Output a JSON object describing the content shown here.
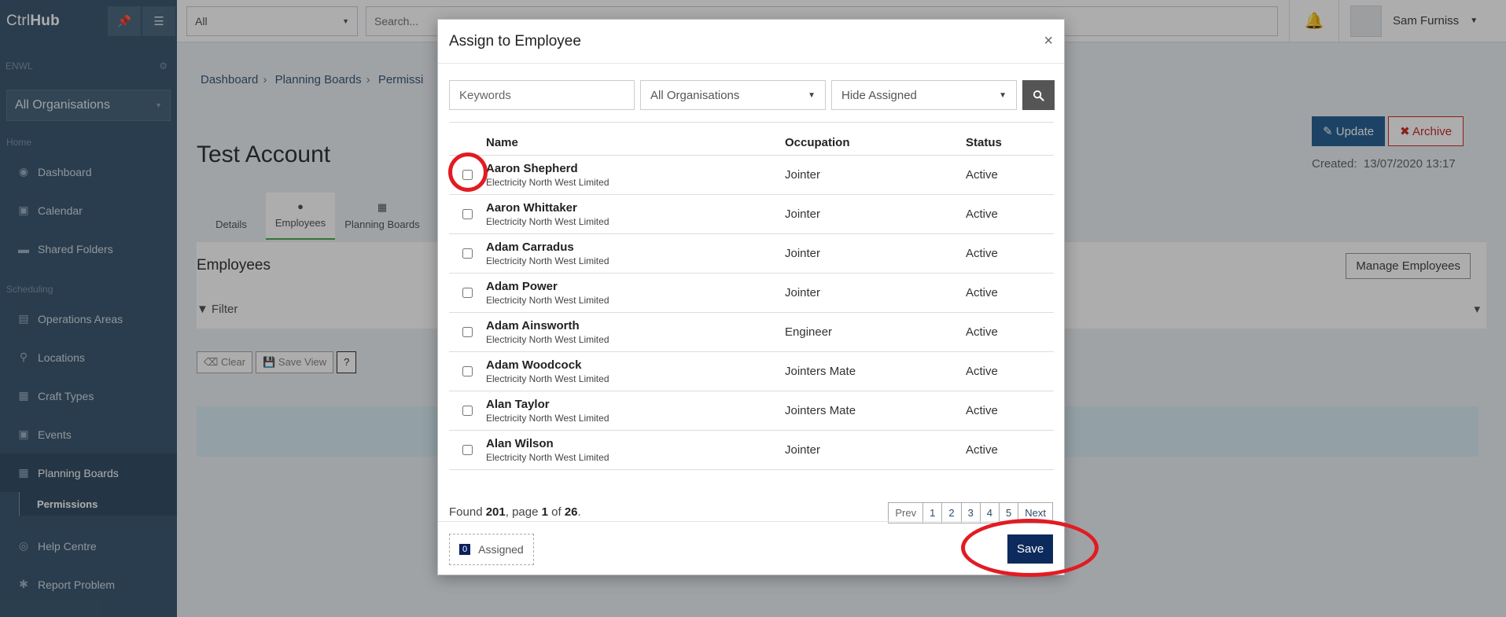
{
  "app": {
    "brand_plain": "Ctrl",
    "brand_bold": "Hub",
    "tenant": "ENWL",
    "org_select": "All Organisations"
  },
  "sidebar": {
    "section_home": "Home",
    "section_scheduling": "Scheduling",
    "items": [
      {
        "label": "Dashboard",
        "icon": "dashboard-icon"
      },
      {
        "label": "Calendar",
        "icon": "calendar-icon"
      },
      {
        "label": "Shared Folders",
        "icon": "folder-icon"
      },
      {
        "label": "Operations Areas",
        "icon": "map-icon"
      },
      {
        "label": "Locations",
        "icon": "pin-icon"
      },
      {
        "label": "Craft Types",
        "icon": "table-icon"
      },
      {
        "label": "Events",
        "icon": "calendar-icon"
      },
      {
        "label": "Planning Boards",
        "icon": "grid-icon"
      }
    ],
    "sub_item": "Permissions",
    "help": "Help Centre",
    "report": "Report Problem"
  },
  "topbar": {
    "select_value": "All",
    "search_placeholder": "Search...",
    "user_name": "Sam Furniss"
  },
  "page": {
    "breadcrumb": [
      "Dashboard",
      "Planning Boards",
      "Permissi"
    ],
    "title": "Test Account",
    "tabs": [
      "Details",
      "Employees",
      "Planning Boards"
    ],
    "update_label": "Update",
    "archive_label": "Archive",
    "created_label": "Created:",
    "created_value": "13/07/2020 13:17",
    "panel_title": "Employees",
    "manage_label": "Manage Employees",
    "filter_label": "Filter",
    "clear_label": "Clear",
    "save_view_label": "Save View",
    "help_glyph": "?"
  },
  "modal": {
    "title": "Assign to Employee",
    "keywords_placeholder": "Keywords",
    "org_filter": "All Organisations",
    "assigned_filter": "Hide Assigned",
    "columns": {
      "name": "Name",
      "occupation": "Occupation",
      "status": "Status"
    },
    "rows": [
      {
        "name": "Aaron Shepherd",
        "org": "Electricity North West Limited",
        "occupation": "Jointer",
        "status": "Active"
      },
      {
        "name": "Aaron Whittaker",
        "org": "Electricity North West Limited",
        "occupation": "Jointer",
        "status": "Active"
      },
      {
        "name": "Adam Carradus",
        "org": "Electricity North West Limited",
        "occupation": "Jointer",
        "status": "Active"
      },
      {
        "name": "Adam Power",
        "org": "Electricity North West Limited",
        "occupation": "Jointer",
        "status": "Active"
      },
      {
        "name": "Adam Ainsworth",
        "org": "Electricity North West Limited",
        "occupation": "Engineer",
        "status": "Active"
      },
      {
        "name": "Adam Woodcock",
        "org": "Electricity North West Limited",
        "occupation": "Jointers Mate",
        "status": "Active"
      },
      {
        "name": "Alan Taylor",
        "org": "Electricity North West Limited",
        "occupation": "Jointers Mate",
        "status": "Active"
      },
      {
        "name": "Alan Wilson",
        "org": "Electricity North West Limited",
        "occupation": "Jointer",
        "status": "Active"
      }
    ],
    "found": {
      "prefix": "Found",
      "total": "201",
      "mid": ", page",
      "page": "1",
      "of": "of",
      "pages": "26",
      "suffix": "."
    },
    "pager": [
      "Prev",
      "1",
      "2",
      "3",
      "4",
      "5",
      "Next"
    ],
    "assigned_count": "0",
    "assigned_label": "Assigned",
    "save_label": "Save"
  },
  "colors": {
    "sidebar": "#3f5b73",
    "primary": "#0d2a5c",
    "highlight_ring": "#e21b23"
  }
}
